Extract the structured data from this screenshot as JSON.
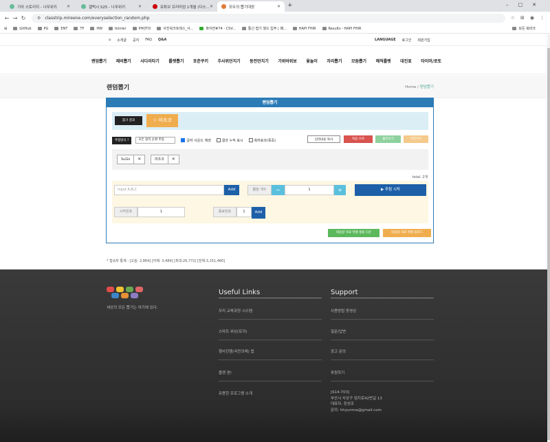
{
  "browser": {
    "tabs": [
      {
        "title": "기아 스토리지 - 나무위키"
      },
      {
        "title": "갤럭시 S25 - 나무위키"
      },
      {
        "title": "유튜브 프리미엄 1개월 (다스..."
      },
      {
        "title": "모두의 뽑기대장"
      }
    ],
    "url": "classtrip.mireene.com/everyselection_random.php",
    "bookmarks": [
      "GitHub",
      "PG",
      "ENT",
      "TF",
      "HW",
      "tkinter",
      "PHOTO",
      "사진워크프레스_사...",
      "파이썬#74 - CSV...",
      "통신 접기 월드 입주 | 패...",
      "HAPI FHIR",
      "Results - HAPI FHIR"
    ],
    "bookmarks_right": "모든 북마크"
  },
  "topbar": {
    "links": [
      "소개글",
      "공지",
      "FAQ",
      "Q&A"
    ],
    "language": "LANGUAGE",
    "login": "로그인",
    "signup": "회원가입"
  },
  "nav": [
    "랜덤뽑기",
    "제비뽑기",
    "사다리타기",
    "룰렛뽑기",
    "포춘쿠키",
    "주사위던지기",
    "동전던지기",
    "가위바위보",
    "윷놀이",
    "자리뽑기",
    "모둠뽑기",
    "해적룰렛",
    "대진표",
    "타이머/로또"
  ],
  "page": {
    "title": "랜덤뽑기",
    "crumb_home": "Home",
    "crumb_sep": "/",
    "crumb_current": "랜덤뽑기"
  },
  "panel": {
    "title": "랜덤뽑기",
    "result_label": "뽑기 결과",
    "result_value": "☆ 마조코",
    "mode_label": "추첨방식 ?",
    "mode_select": "모든 항목 순환 추첨",
    "opt_sound": "글자 사운드 재생",
    "opt_cumulative": "결과 누적 표시",
    "opt_effect": "축하효과(폭죽)",
    "btn_copy": "입력내용 복사",
    "btn_reset": "처음 으로",
    "btn_load": "불러오기",
    "btn_save": "저장하기",
    "items": [
      "SuGo",
      "마조코"
    ],
    "total": "total: 2개",
    "input_placeholder": "Input A,B,C",
    "btn_add": "Add",
    "count_label": "뽑을 개수",
    "count_value": "1",
    "btn_start": "▶ 추첨 시작",
    "start_label": "시작번호",
    "start_value": "1",
    "end_label": "종료번호",
    "end_value": "1",
    "btn_add2": "Add",
    "btn_download": "대용량 자료 엑셀 샘플 다운",
    "btn_upload": "대용량 자료 엑셀 업로드"
  },
  "stats": "* 접속자 통계 : [오늘: 2,864] [어제: 3,484] [최대:26,772] [전체:3,151,480]",
  "footer": {
    "slogan": "세상의 모든 뽑기는 여기에 있다.",
    "useful_title": "Useful Links",
    "useful_links": [
      "우리 교육과정 시스템",
      "스마트 워싱(토끼)",
      "행사진행(국민의례) 앱",
      "플랫 편!",
      "유용한 프로그램 소개"
    ],
    "support_title": "Support",
    "support_links": [
      "사용방법 동영상",
      "질문/답변",
      "광고 문의",
      "후원하기"
    ],
    "address": [
      "[614-703]",
      "부산시 사상구 엄지로42번길 13",
      "대표자: 장성조",
      "문의: hhyunma@gmail.com"
    ]
  },
  "colors": {
    "primary": "#2b7bb6",
    "orange": "#f0ad4e",
    "red": "#d9534f",
    "green": "#5cb85c",
    "navy": "#1d5fa8"
  }
}
